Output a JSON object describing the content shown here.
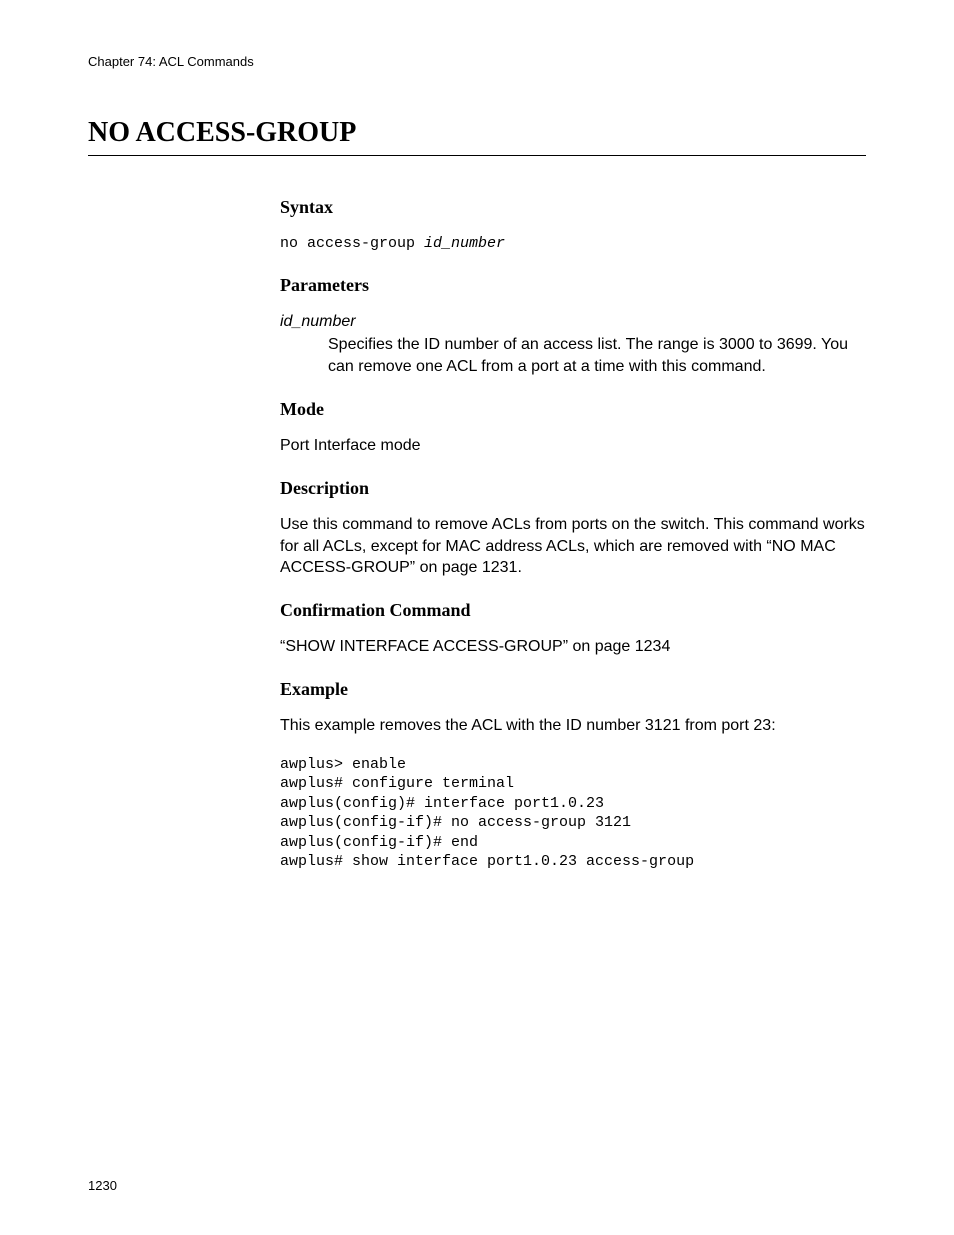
{
  "header": {
    "chapter": "Chapter 74: ACL Commands"
  },
  "title": "NO ACCESS-GROUP",
  "syntax": {
    "heading": "Syntax",
    "command_prefix": "no access-group ",
    "command_arg": "id_number"
  },
  "parameters": {
    "heading": "Parameters",
    "name": "id_number",
    "description": "Specifies the ID number of an access list. The range is 3000 to 3699. You can remove one ACL from a port at a time with this command."
  },
  "mode": {
    "heading": "Mode",
    "text": "Port Interface mode"
  },
  "description": {
    "heading": "Description",
    "text": "Use this command to remove ACLs from ports on the switch. This command works for all ACLs, except for MAC address ACLs, which are removed with “NO MAC ACCESS-GROUP” on page 1231."
  },
  "confirmation": {
    "heading": "Confirmation Command",
    "text": "“SHOW INTERFACE ACCESS-GROUP” on page 1234"
  },
  "example": {
    "heading": "Example",
    "intro": "This example removes the ACL with the ID number 3121 from port 23:",
    "code": "awplus> enable\nawplus# configure terminal\nawplus(config)# interface port1.0.23\nawplus(config-if)# no access-group 3121\nawplus(config-if)# end\nawplus# show interface port1.0.23 access-group"
  },
  "page_number": "1230"
}
